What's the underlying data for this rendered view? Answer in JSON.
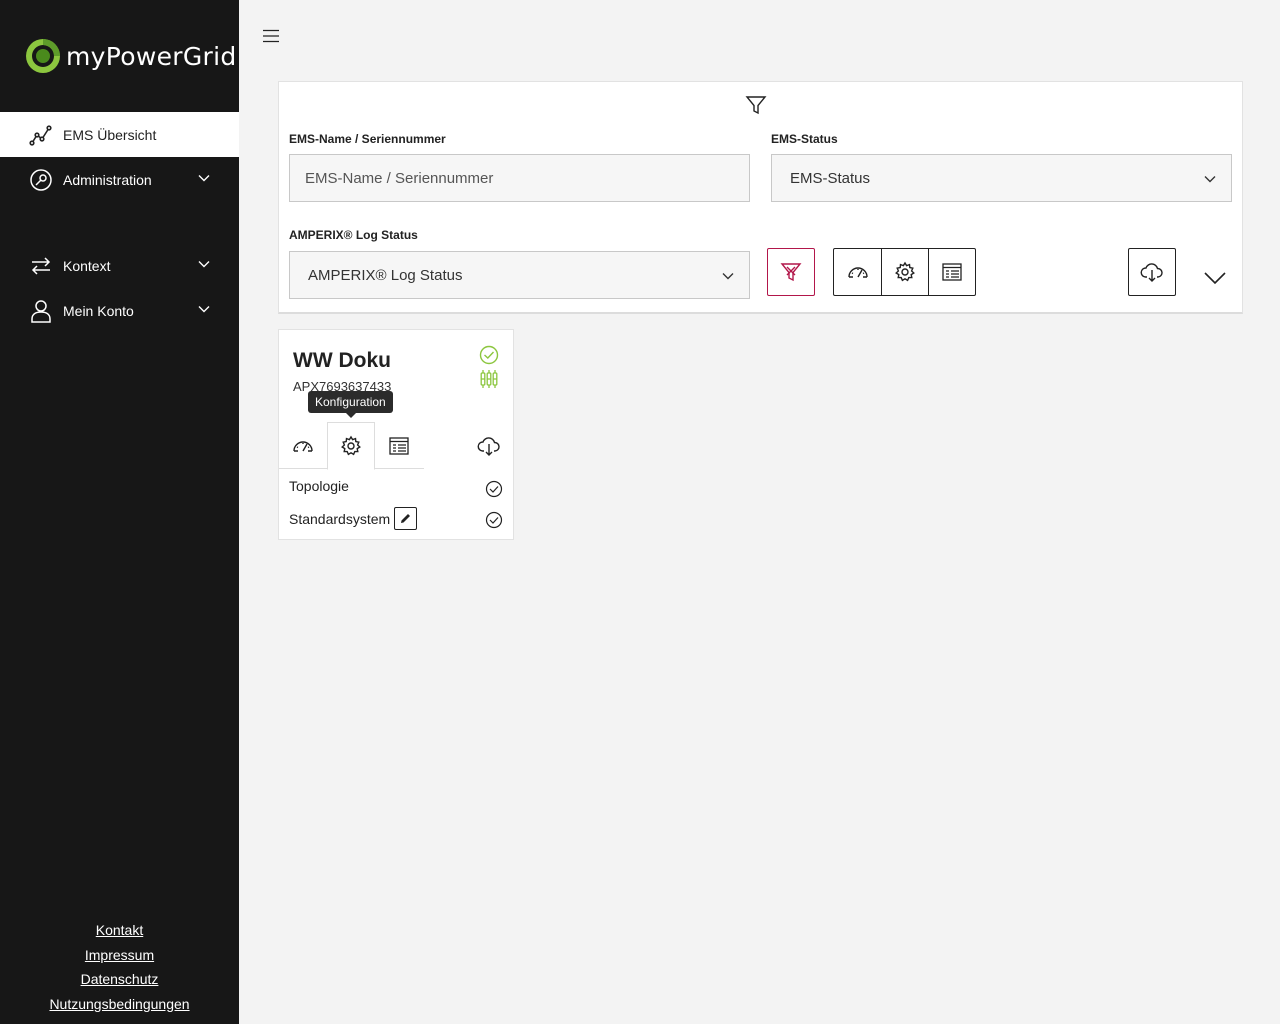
{
  "brand": {
    "name": "myPowerGrid",
    "accent": "#8cc63f"
  },
  "sidebar": {
    "items": [
      {
        "label": "EMS Übersicht",
        "icon": "chart-line-icon",
        "active": true
      },
      {
        "label": "Administration",
        "icon": "admin-gear-icon",
        "expandable": true
      },
      {
        "label": "Kontext",
        "icon": "swap-arrows-icon",
        "expandable": true
      },
      {
        "label": "Mein Konto",
        "icon": "user-icon",
        "expandable": true
      }
    ],
    "footer": [
      "Kontakt",
      "Impressum",
      "Datenschutz",
      "Nutzungsbedingungen"
    ]
  },
  "filters": {
    "name_label": "EMS-Name / Seriennummer",
    "name_placeholder": "EMS-Name / Seriennummer",
    "status_label": "EMS-Status",
    "status_value": "EMS-Status",
    "log_label": "AMPERIX® Log Status",
    "log_value": "AMPERIX® Log Status"
  },
  "card": {
    "title": "WW Doku",
    "serial": "APX7693637433",
    "tooltip": "Konfiguration",
    "rows": [
      {
        "label": "Topologie",
        "status": "ok"
      },
      {
        "label": "Standardsystem",
        "status": "ok",
        "editable": true
      }
    ],
    "status_color": "#8cc63f"
  }
}
